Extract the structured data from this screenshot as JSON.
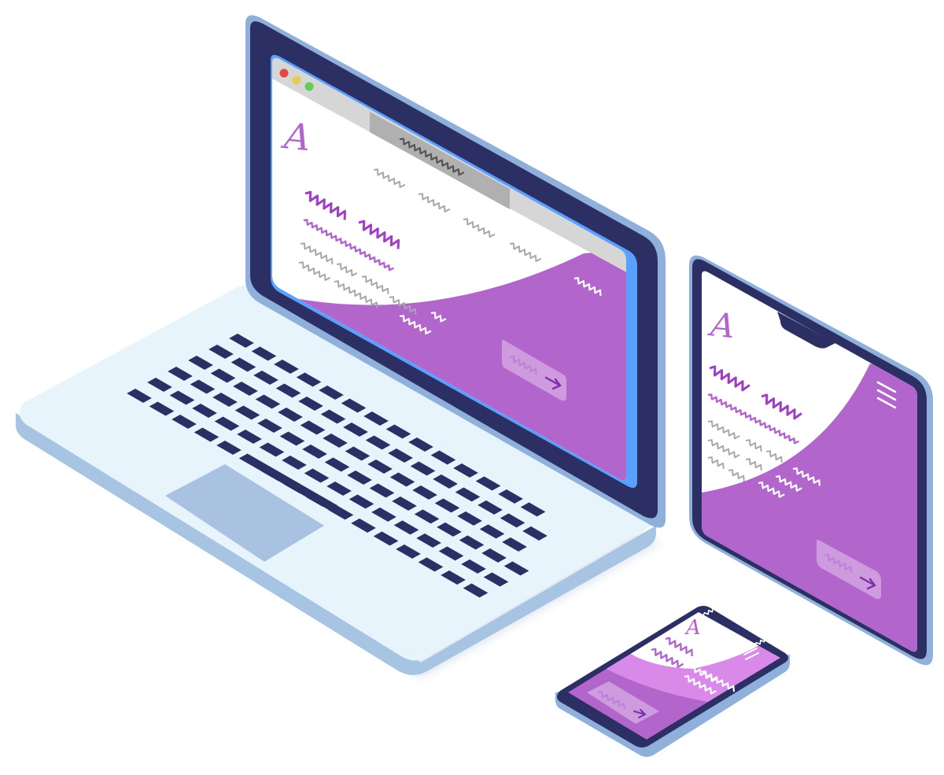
{
  "logo_glyph": "A",
  "colors": {
    "purple": "#b266cc",
    "purple_text": "#9f3fc4",
    "navy": "#2b2f63",
    "laptop_bezel_light": "#8fb0da",
    "laptop_screen_edge": "#5aa0ff",
    "laptop_base": "#e8f4fc",
    "laptop_base_side": "#a7c4e2",
    "trackpad": "#a9c2e2",
    "key": "#2b2f63",
    "placeholder_gray": "#a8a8a8",
    "titlebar": "#d6d6d6",
    "addressbar": "#b0b0b0",
    "traffic_red": "#e04848",
    "traffic_yellow": "#e8c95a",
    "traffic_green": "#5fcf55",
    "button_overlay": "rgba(255,255,255,0.35)"
  },
  "icons": {
    "window_controls": [
      "close-dot",
      "minimize-dot",
      "maximize-dot"
    ],
    "cta_arrow": "arrow-right-icon",
    "menu": "hamburger-menu-icon"
  },
  "devices": [
    "laptop",
    "tablet",
    "phone"
  ]
}
